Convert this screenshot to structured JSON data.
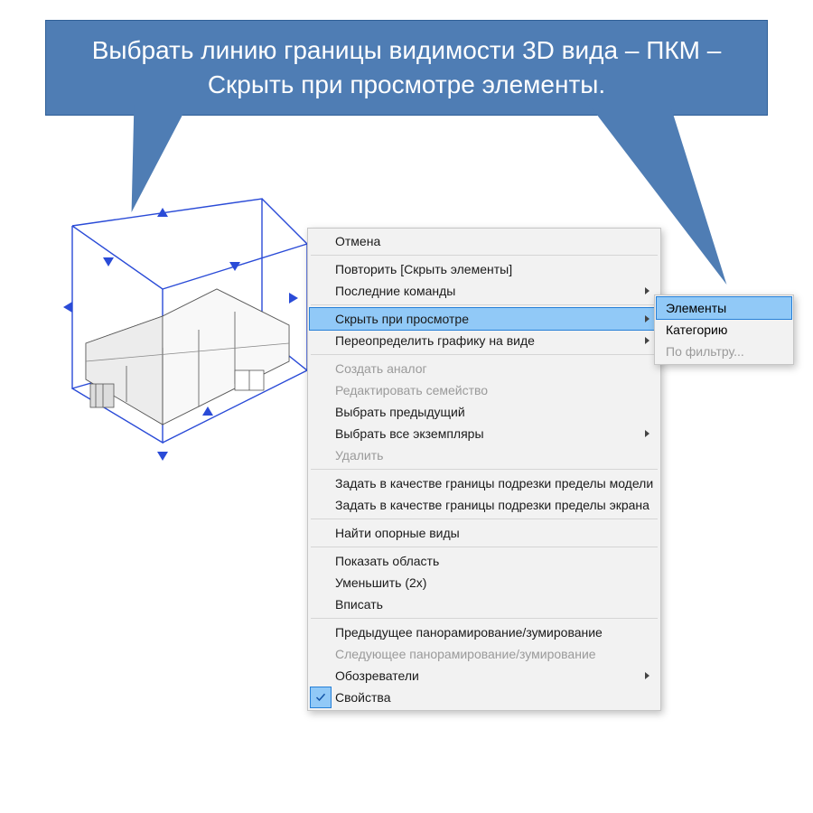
{
  "callout": {
    "text": "Выбрать линию границы видимости 3D вида – ПКМ – Скрыть при просмотре элементы."
  },
  "context_menu": {
    "items": [
      {
        "label": "Отмена",
        "enabled": true,
        "arrow": false
      },
      {
        "sep": true
      },
      {
        "label": "Повторить [Скрыть элементы]",
        "enabled": true,
        "arrow": false
      },
      {
        "label": "Последние команды",
        "enabled": true,
        "arrow": true
      },
      {
        "sep": true
      },
      {
        "label": "Скрыть при просмотре",
        "enabled": true,
        "arrow": true,
        "highlight": true
      },
      {
        "label": "Переопределить графику на виде",
        "enabled": true,
        "arrow": true
      },
      {
        "sep": true
      },
      {
        "label": "Создать аналог",
        "enabled": false,
        "arrow": false
      },
      {
        "label": "Редактировать семейство",
        "enabled": false,
        "arrow": false
      },
      {
        "label": "Выбрать предыдущий",
        "enabled": true,
        "arrow": false
      },
      {
        "label": "Выбрать все экземпляры",
        "enabled": true,
        "arrow": true
      },
      {
        "label": "Удалить",
        "enabled": false,
        "arrow": false
      },
      {
        "sep": true
      },
      {
        "label": "Задать в качестве границы подрезки пределы модели",
        "enabled": true,
        "arrow": false
      },
      {
        "label": "Задать в качестве границы подрезки пределы экрана",
        "enabled": true,
        "arrow": false
      },
      {
        "sep": true
      },
      {
        "label": "Найти опорные виды",
        "enabled": true,
        "arrow": false
      },
      {
        "sep": true
      },
      {
        "label": "Показать область",
        "enabled": true,
        "arrow": false
      },
      {
        "label": "Уменьшить (2x)",
        "enabled": true,
        "arrow": false
      },
      {
        "label": "Вписать",
        "enabled": true,
        "arrow": false
      },
      {
        "sep": true
      },
      {
        "label": "Предыдущее панорамирование/зумирование",
        "enabled": true,
        "arrow": false
      },
      {
        "label": "Следующее панорамирование/зумирование",
        "enabled": false,
        "arrow": false
      },
      {
        "label": "Обозреватели",
        "enabled": true,
        "arrow": true
      },
      {
        "label": "Свойства",
        "enabled": true,
        "arrow": false,
        "check": true
      }
    ]
  },
  "submenu": {
    "items": [
      {
        "label": "Элементы",
        "enabled": true,
        "highlight": true
      },
      {
        "label": "Категорию",
        "enabled": true
      },
      {
        "label": "По фильтру...",
        "enabled": false
      }
    ]
  },
  "colors": {
    "callout_bg": "#4f7db4",
    "highlight": "#91c9f7",
    "highlight_border": "#2680d8",
    "menu_bg": "#f2f2f2"
  }
}
